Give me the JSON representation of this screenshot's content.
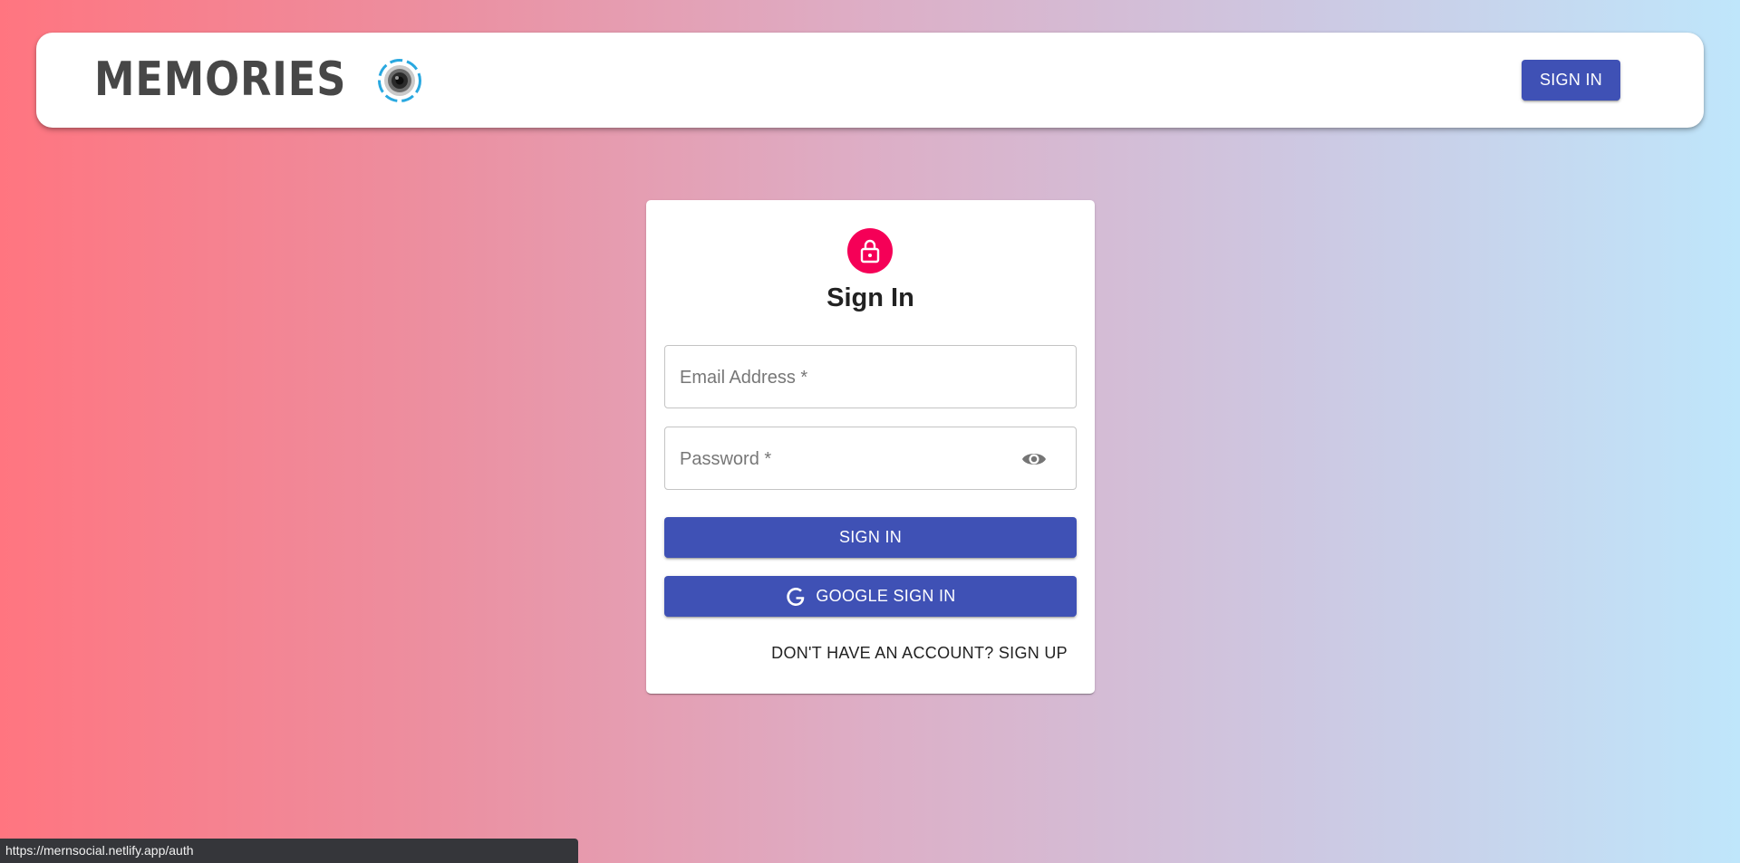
{
  "header": {
    "brand_text": "MEMORIES",
    "brand_logo_icon": "camera-lens-icon",
    "signin_label": "SIGN IN"
  },
  "auth_card": {
    "lock_icon": "lock-icon",
    "title": "Sign In",
    "email_placeholder": "Email Address *",
    "email_value": "",
    "password_placeholder": "Password *",
    "password_value": "",
    "password_toggle_icon": "eye-icon",
    "signin_label": "SIGN IN",
    "google_icon": "google-icon",
    "google_label": "GOOGLE SIGN IN",
    "switch_label": "DON'T HAVE AN ACCOUNT? SIGN UP"
  },
  "status_bar": {
    "url": "https://mernsocial.netlify.app/auth"
  },
  "colors": {
    "primary": "#3f51b5",
    "secondary": "#f50057",
    "gradient_start": "#ff7580",
    "gradient_end": "#bfe6fb"
  }
}
